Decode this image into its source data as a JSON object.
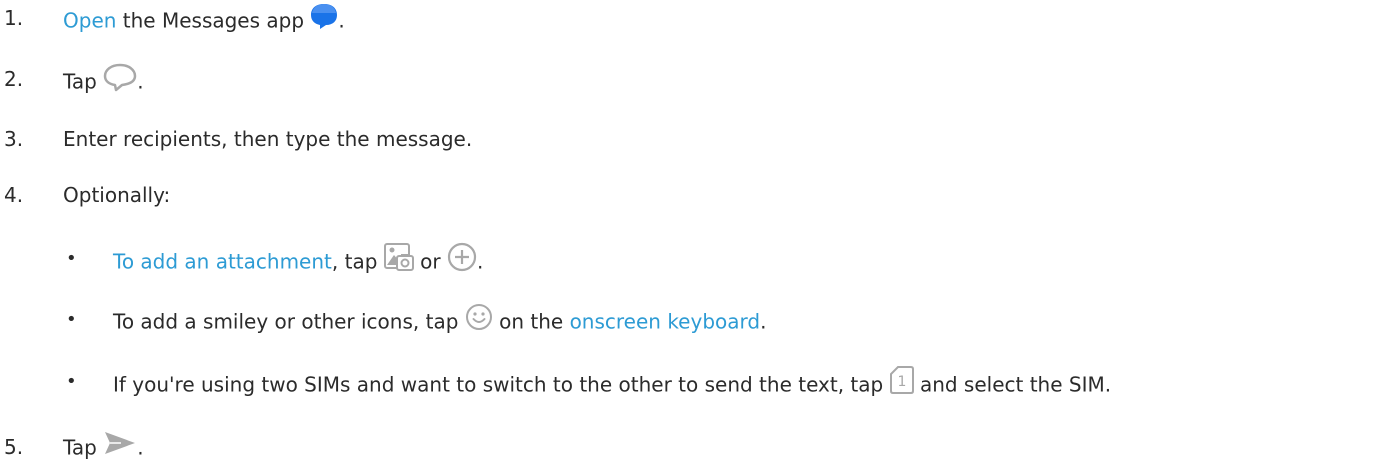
{
  "steps": [
    {
      "number": "1.",
      "link": "Open",
      "text": " the Messages app",
      "end": "."
    },
    {
      "number": "2.",
      "text": "Tap",
      "end": "."
    },
    {
      "number": "3.",
      "text": "Enter recipients, then type the message."
    },
    {
      "number": "4.",
      "text": "Optionally:"
    },
    {
      "number": "5.",
      "text": "Tap",
      "end": "."
    }
  ],
  "sub_steps": [
    {
      "bullet": "•",
      "link": "To add an attachment",
      "text": ", tap",
      "middle": "or",
      "end": "."
    },
    {
      "bullet": "•",
      "text": "To add a smiley or other icons, tap",
      "middle": "on the",
      "link": "onscreen keyboard",
      "end": "."
    },
    {
      "bullet": "•",
      "text": "If you're using two SIMs and want to switch to the other to send the text, tap",
      "middle": "and select the SIM."
    }
  ],
  "icons": [
    "messages-app-icon",
    "new-chat-icon",
    "gallery-attach-icon",
    "add-circle-icon",
    "emoji-icon",
    "sim-1-icon",
    "send-icon"
  ],
  "sim_badge": "1",
  "colors": {
    "link": "#2d9bd4",
    "text": "#2b2b2b",
    "messages_app": "#1a73e8",
    "icon_gray": "#a8a8a8"
  }
}
